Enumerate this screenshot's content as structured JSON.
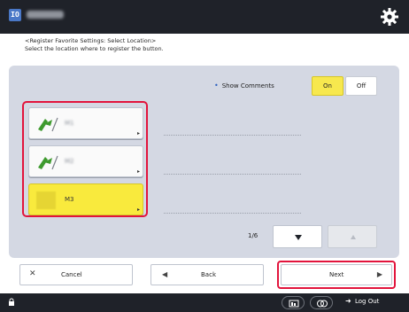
{
  "header": {
    "app_icon_glyph": "IO",
    "device_name": "######",
    "settings_icon": "gear-icon"
  },
  "instructions": {
    "line1": "<Register Favorite Settings: Select Location>",
    "line2": "Select the location where to register the button."
  },
  "show_comments": {
    "label": "Show Comments",
    "on_label": "On",
    "off_label": "Off",
    "selected": "On"
  },
  "slots": [
    {
      "label": "M1",
      "icon": "favorite-settings-icon",
      "selected": false
    },
    {
      "label": "M2",
      "icon": "favorite-settings-icon",
      "selected": false
    },
    {
      "label": "M3",
      "icon": "empty-slot-icon",
      "selected": true
    }
  ],
  "pagination": {
    "page": "1/6",
    "down_icon": "triangle-down-icon",
    "up_icon": "triangle-up-icon"
  },
  "footer": {
    "cancel_label": "Cancel",
    "back_label": "Back",
    "next_label": "Next"
  },
  "statusbar": {
    "logout_label": "Log Out"
  },
  "colors": {
    "highlight": "#e2143c",
    "selected_yellow": "#f9ea3d",
    "panel": "#d4d8e3",
    "bar": "#1f2229"
  }
}
